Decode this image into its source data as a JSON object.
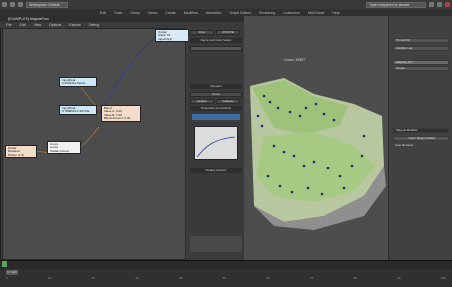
{
  "app": {
    "workspace": "Workspace: Default",
    "search_placeholder": "Type a keyword or phrase"
  },
  "menu": [
    "Edit",
    "Tools",
    "Group",
    "Views",
    "Create",
    "Modifiers",
    "Animation",
    "Graph Editors",
    "Rendering",
    "Customize",
    "MAXScript",
    "Help"
  ],
  "magma_window": {
    "title": "[EXAMPLES] MagmaFlow",
    "menu": [
      "File",
      "Edit",
      "View",
      "Options",
      "Expose",
      "Debug"
    ],
    "side_tabs": [
      "Flow",
      "UPDATE"
    ],
    "side_section": "Name and Color Select",
    "operator_section": "Operator",
    "operator_value": "Curve",
    "buttons": [
      "Enable",
      "Collapse"
    ],
    "properties_section": "Properties and Actions",
    "display_section": "Display Options"
  },
  "nodes": [
    {
      "id": "out",
      "title": "Output",
      "rows": [
        "Stack: #1",
        "InputCh(1)"
      ],
      "color": "#d9e9f5"
    },
    {
      "id": "input1",
      "title": "InputFloat",
      "rows": [
        "0.3522311-Vector"
      ],
      "color": "#cde6f5"
    },
    {
      "id": "input2",
      "title": "InputFloat",
      "rows": [
        "0.7886621-0.327311"
      ],
      "color": "#cde6f5"
    },
    {
      "id": "blend",
      "title": "Blend",
      "rows": [
        "Value A: 0.00",
        "Value B: 1.00",
        "Blend Amount: 0.40"
      ],
      "color": "#f5dcc8"
    },
    {
      "id": "curve",
      "title": "Curve",
      "rows": [
        "Curve",
        "Scalar (Curve)"
      ],
      "color": "#f2f2f2"
    },
    {
      "id": "divide",
      "title": "Divide",
      "rows": [
        "Dividend",
        "Divisor (1.0)"
      ],
      "color": "#f5dcc8"
    }
  ],
  "viewport": {
    "label": "Count: 39997"
  },
  "command_panel": {
    "object_name": "Terrain001",
    "modifier_list": "Modifier List",
    "modifiers": [
      "Magma_FLT",
      "Terrain"
    ],
    "params_title": "Magma Modifier",
    "open_button": "Open Magma Editor",
    "checkbox": "Auto Rename"
  },
  "timeline": {
    "ticks": [
      "0",
      "10",
      "20",
      "30",
      "40",
      "50",
      "60",
      "70",
      "80",
      "90",
      "100"
    ],
    "frame": "0 / 100"
  }
}
